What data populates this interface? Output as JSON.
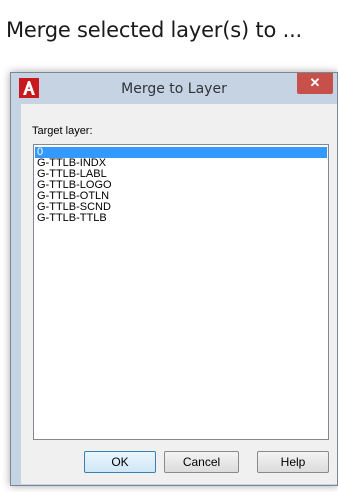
{
  "headline": "Merge selected layer(s) to ...",
  "dialog": {
    "title": "Merge to Layer",
    "close_glyph": "✕",
    "app_icon": "autocad-a-icon",
    "target_label": "Target layer:",
    "layers": [
      "0",
      "G-TTLB-INDX",
      "G-TTLB-LABL",
      "G-TTLB-LOGO",
      "G-TTLB-OTLN",
      "G-TTLB-SCND",
      "G-TTLB-TTLB"
    ],
    "selected_layer": "0",
    "buttons": {
      "ok": "OK",
      "cancel": "Cancel",
      "help": "Help"
    }
  },
  "colors": {
    "selection": "#3399ff",
    "close_button": "#c7504a",
    "frame": "#c6d3e2",
    "app_icon_red": "#c8191f"
  }
}
